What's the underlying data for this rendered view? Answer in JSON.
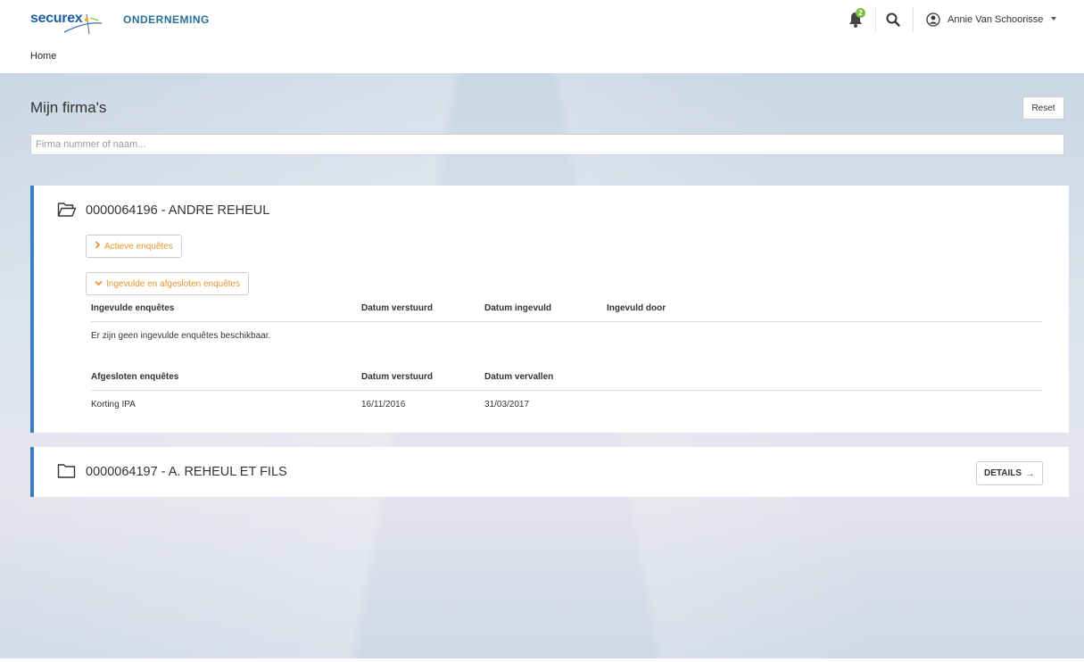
{
  "header": {
    "logo_text": "securex",
    "app_title": "ONDERNEMING",
    "notification_count": "2",
    "user_name": "Annie Van Schoorisse"
  },
  "breadcrumb": {
    "home": "Home"
  },
  "page": {
    "title": "Mijn firma's",
    "reset_label": "Reset",
    "search_placeholder": "Firma nummer of naam..."
  },
  "companies": [
    {
      "title": "0000064196 - ANDRE REHEUL",
      "expanded": true,
      "active_toggle": "Actieve enquêtes",
      "closed_toggle": "Ingevulde en afgesloten enquêtes",
      "filled_table": {
        "headers": [
          "Ingevulde enquêtes",
          "Datum verstuurd",
          "Datum ingevuld",
          "Ingevuld door"
        ],
        "empty_message": "Er zijn geen ingevulde enquêtes beschikbaar."
      },
      "closed_table": {
        "headers": [
          "Afgesloten enquêtes",
          "Datum verstuurd",
          "Datum vervallen"
        ],
        "rows": [
          [
            "Korting IPA",
            "16/11/2016",
            "31/03/2017"
          ]
        ]
      }
    },
    {
      "title": "0000064197 - A. REHEUL ET FILS",
      "expanded": false,
      "details_label": "DETAILS",
      "details_arrow": "→"
    }
  ],
  "colors": {
    "accent_blue": "#3d7ebf",
    "orange": "#e5962a",
    "badge_green": "#7cbf3f"
  }
}
